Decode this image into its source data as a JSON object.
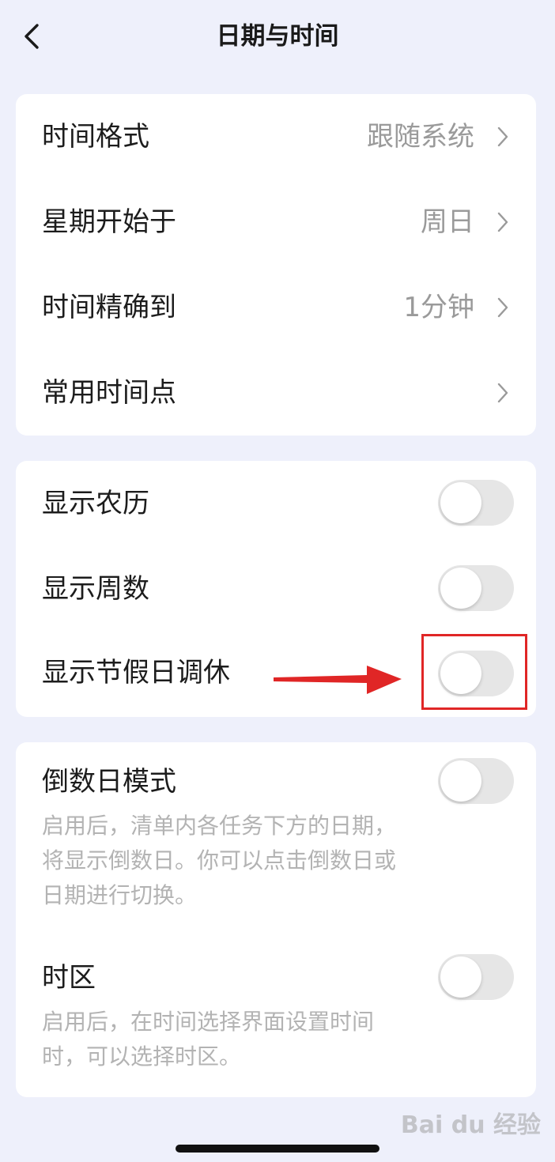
{
  "header": {
    "title": "日期与时间",
    "back_icon": "chevron-left-icon"
  },
  "general": {
    "items": [
      {
        "label": "时间格式",
        "value": "跟随系统"
      },
      {
        "label": "星期开始于",
        "value": "周日"
      },
      {
        "label": "时间精确到",
        "value": "1分钟"
      },
      {
        "label": "常用时间点",
        "value": ""
      }
    ]
  },
  "display": {
    "items": [
      {
        "label": "显示农历",
        "enabled": false
      },
      {
        "label": "显示周数",
        "enabled": false
      },
      {
        "label": "显示节假日调休",
        "enabled": false
      }
    ]
  },
  "advanced": {
    "countdown": {
      "label": "倒数日模式",
      "enabled": false,
      "desc": "启用后，清单内各任务下方的日期，将显示倒数日。你可以点击倒数日或日期进行切换。"
    },
    "timezone": {
      "label": "时区",
      "enabled": false,
      "desc": "启用后，在时间选择界面设置时间时，可以选择时区。"
    }
  },
  "annotation": {
    "box_color": "#e02626",
    "arrow_color": "#e02626"
  },
  "colors": {
    "background": "#eef0fb",
    "card": "#ffffff",
    "toggle_off": "#e6e6e6",
    "secondary_text": "#9a9a9a"
  },
  "watermark": {
    "text": "Bai du 经验"
  }
}
